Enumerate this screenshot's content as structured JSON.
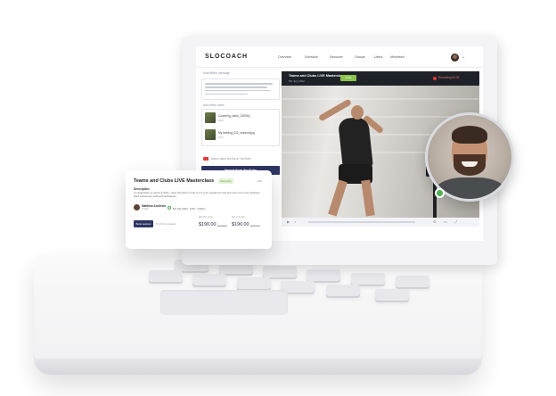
{
  "app": {
    "brand": "SLOCOACH"
  },
  "nav": {
    "items": [
      "Overview",
      "Schedule",
      "Sessions",
      "Groups",
      "Users",
      "Messfeed"
    ]
  },
  "sidebar": {
    "message_title": "Note/offline message",
    "files_title": "Add offline notes",
    "files": [
      {
        "name": "Coaching_video_230918_",
        "size": "MP4"
      },
      {
        "name": "My training_012_workout.jpg",
        "size": "JPG"
      }
    ],
    "youtube_text": "Add a video via link or YouTube",
    "import_button": "Import from YouTube"
  },
  "video": {
    "title": "Teams and Clubs LIVE Masterclass",
    "date": "5th July 2022",
    "badge": "Online",
    "recording_label": "Recording 00:36"
  },
  "card": {
    "title": "Teams and Clubs LIVE Masterclass",
    "badge": "Upcoming",
    "edit": "Edit",
    "description_label": "Description",
    "description": "A masterclass on teams & clubs - learn the latest in how to run your programme and get more out of your sessions. We'll explore key skills and techniques.",
    "coach_name": "Matthew Andrews",
    "coach_role": "Coach",
    "time": "5th July 2022 · 6:00 - 7:00pm",
    "button": "Book session",
    "join_text": "15 of 20 completed",
    "prices": [
      {
        "label": "Member price",
        "value": "$190.00",
        "old": "$240.00"
      },
      {
        "label": "Non-member",
        "value": "$190.00",
        "old": "$240.00"
      }
    ]
  },
  "colors": {
    "accent": "#2f3562",
    "live": "#8bc34a",
    "record": "#e53935",
    "online_dot": "#4caf50"
  }
}
